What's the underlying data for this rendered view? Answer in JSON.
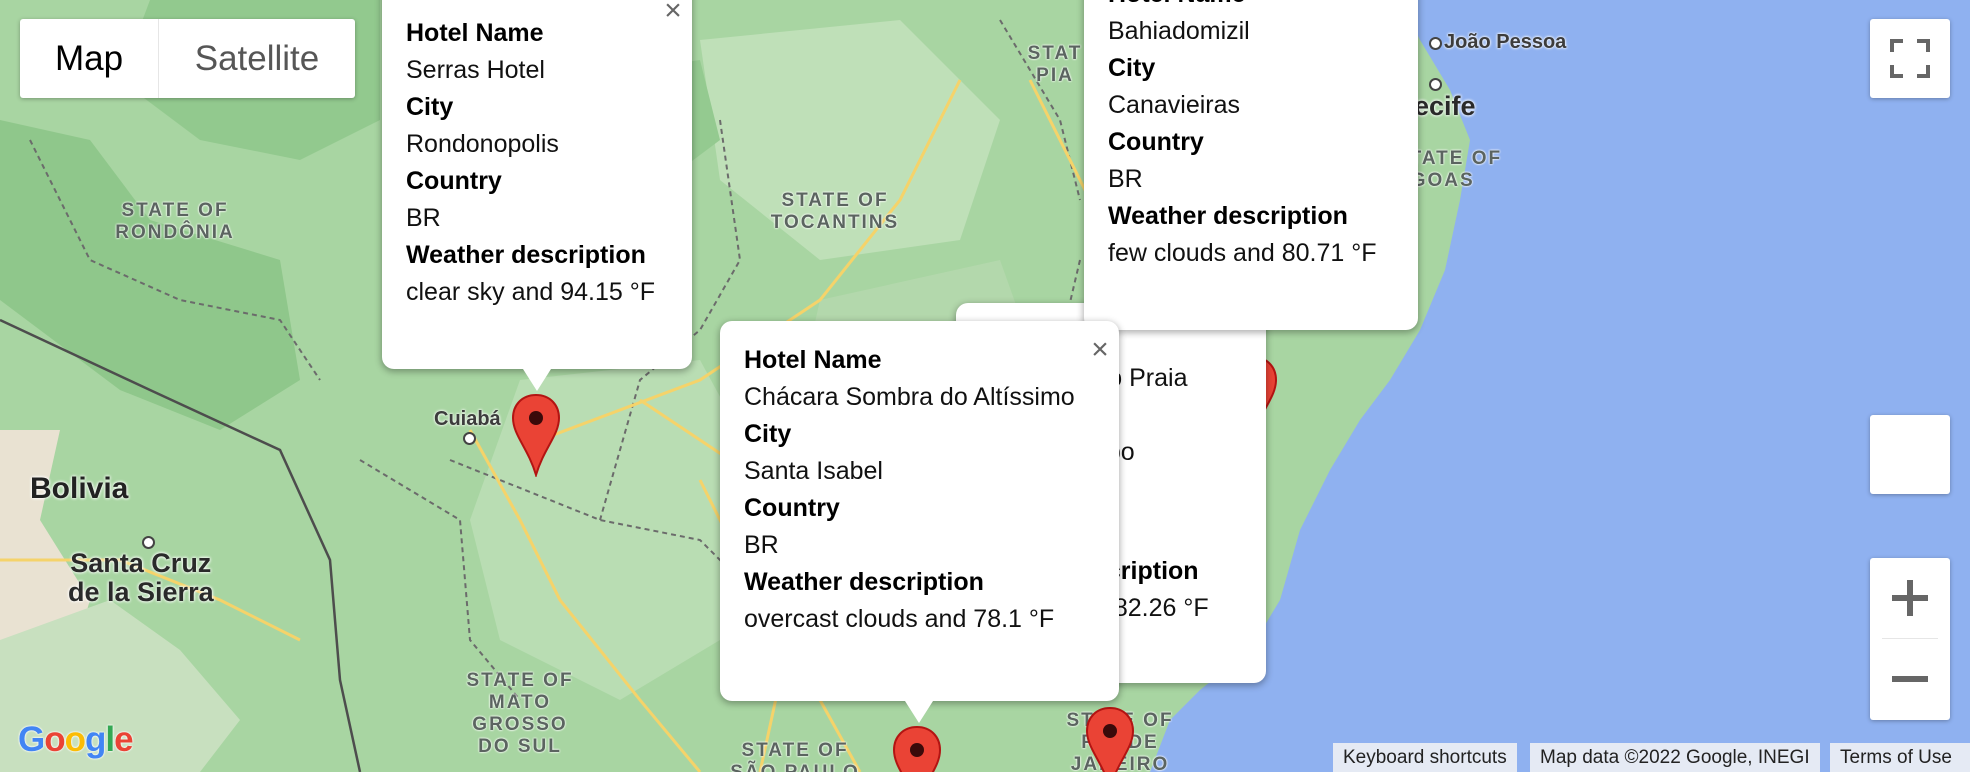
{
  "map_type": {
    "map_label": "Map",
    "satellite_label": "Satellite",
    "selected": "Map"
  },
  "controls": {
    "fullscreen_icon": "fullscreen-icon",
    "zoom_in_icon": "plus-icon",
    "zoom_out_icon": "minus-icon"
  },
  "map_labels": {
    "state_rondonia": "STATE OF\nRONDÔNIA",
    "state_tocantins": "STATE OF\nTOCANTINS",
    "state_mato_grosso_do_sul": "STATE OF\nMATO\nGROSSO\nDO SUL",
    "state_sao_paulo": "STATE OF\nSÃO PAULO",
    "state_rio": "STATE OF\nRIO DE\nJANEIRO",
    "state_piaui": "STAT\nPIA",
    "state_alagoas": "STATE OF\nAGOAS",
    "bolivia": "Bolivia",
    "santa_cruz": "Santa Cruz\nde la Sierra",
    "cuiaba": "Cuiabá",
    "joao_pessoa": "João Pessoa",
    "recife": "ecife"
  },
  "info_windows": [
    {
      "hotel_label": "Hotel Name",
      "hotel": "Serras Hotel",
      "city_label": "City",
      "city": "Rondonopolis",
      "country_label": "Country",
      "country": "BR",
      "weather_label": "Weather description",
      "weather": "clear sky and 94.15 °F"
    },
    {
      "hotel_label": "Hotel Name",
      "hotel": "Bahiadomizil",
      "city_label": "City",
      "city": "Canavieiras",
      "country_label": "Country",
      "country": "BR",
      "weather_label": "Weather description",
      "weather": "few clouds and 80.71 °F"
    },
    {
      "hotel_label": "Hotel Name",
      "hotel": "Chácara Sombra do Altíssimo",
      "city_label": "City",
      "city": "Santa Isabel",
      "country_label": "Country",
      "country": "BR",
      "weather_label": "Weather description",
      "weather": "overcast clouds and 78.1 °F"
    },
    {
      "hotel_fragment": "rto Praia",
      "city_fragment": "abo",
      "weather_label_fragment": "scription",
      "weather_fragment": "d 82.26 °F"
    }
  ],
  "attribution": {
    "shortcuts": "Keyboard shortcuts",
    "map_data": "Map data ©2022 Google, INEGI",
    "terms": "Terms of Use"
  },
  "logo": "Google",
  "colors": {
    "land": "#a8d5a2",
    "ocean": "#8fb1f0",
    "marker": "#ea4335",
    "road": "#f5d36a",
    "border": "#6b6b6b"
  }
}
